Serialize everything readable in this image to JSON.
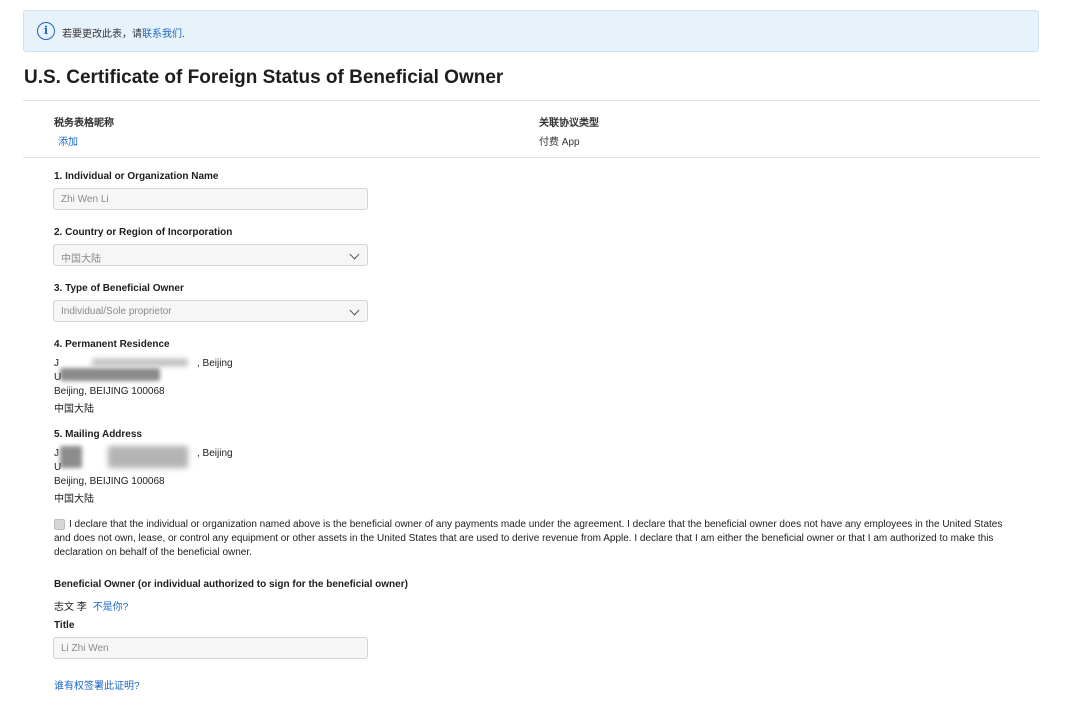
{
  "banner": {
    "text": "若要更改此表，请",
    "link": "联系我们",
    "suffix": "."
  },
  "page_title": "U.S. Certificate of Foreign Status of Beneficial Owner",
  "meta": {
    "nickname_label": "税务表格昵称",
    "nickname_action": "添加",
    "agreement_label": "关联协议类型",
    "agreement_value": "付费 App"
  },
  "fields": {
    "name": {
      "label": "1. Individual or Organization Name",
      "value": "Zhi Wen Li"
    },
    "country": {
      "label": "2. Country or Region of Incorporation",
      "value": "中国大陆"
    },
    "type": {
      "label": "3. Type of Beneficial Owner",
      "value": "Individual/Sole proprietor"
    },
    "permanent": {
      "label": "4. Permanent Residence",
      "line1_visible": "J",
      "line1_end": ", Beijing",
      "line2_visible": "U",
      "line3": "Beijing, BEIJING 100068",
      "line4": "中国大陆"
    },
    "mailing": {
      "label": "5. Mailing Address",
      "line1_visible": "J",
      "line1_end": ", Beijing",
      "line2_visible": "U",
      "line3": "Beijing, BEIJING 100068",
      "line4": "中国大陆"
    }
  },
  "declaration": "I declare that the individual or organization named above is the beneficial owner of any payments made under the agreement. I declare that the beneficial owner does not have any employees in the United States and does not own, lease, or control any equipment or other assets in the United States that are used to derive revenue from Apple. I declare that I am either the beneficial owner or that I am authorized to make this declaration on behalf of the beneficial owner.",
  "signer": {
    "label": "Beneficial Owner (or individual authorized to sign for the beneficial owner)",
    "name": "志文 李",
    "not_you": "不是你?"
  },
  "title_field": {
    "label": "Title",
    "value": "Li Zhi Wen"
  },
  "who_link": "谁有权签署此证明?"
}
